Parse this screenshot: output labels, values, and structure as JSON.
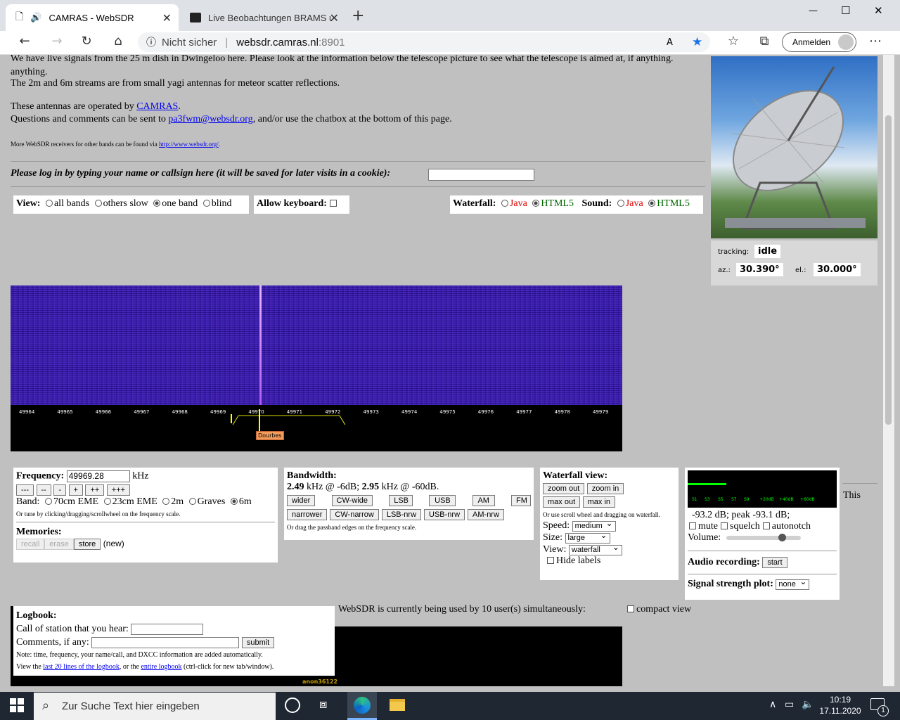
{
  "browser": {
    "tabs": [
      {
        "title": "CAMRAS - WebSDR",
        "close": "✕"
      },
      {
        "title": "Live Beobachtungen BRAMS und",
        "close": "✕"
      }
    ],
    "new_tab": "+",
    "window_controls": {
      "minimize": "—",
      "maximize": "☐",
      "close": "✕"
    },
    "security_label": "Nicht sicher",
    "url_host": "websdr.camras.nl",
    "url_port": ":8901",
    "signin_label": "Anmelden"
  },
  "intro": {
    "line1": "We have live signals from the 25 m dish in Dwingeloo here. Please look at the information below the telescope picture to see what the telescope is aimed at, if anything.",
    "line2": "The 2m and 6m streams are from small yagi antennas for meteor scatter reflections.",
    "operated_prefix": "These antennas are operated by ",
    "operated_link": "CAMRAS",
    "operated_suffix": ".",
    "questions_prefix": "Questions and comments can be sent to ",
    "questions_link": "pa3fwm@websdr.org",
    "questions_suffix": ", and/or use the chatbox at the bottom of this page.",
    "more_prefix": "More WebSDR receivers for other bands can be found via ",
    "more_link": "http://www.websdr.org/",
    "more_suffix": "."
  },
  "login": {
    "prompt": "Please log in by typing your name or callsign here (it will be saved for later visits in a cookie):",
    "value": ""
  },
  "view": {
    "label": "View:",
    "options": [
      "all bands",
      "others slow",
      "one band",
      "blind"
    ],
    "selected": "one band"
  },
  "keyboard": {
    "label": "Allow keyboard:"
  },
  "waterfall_mode": {
    "label": "Waterfall:",
    "java": "Java",
    "html5": "HTML5"
  },
  "sound_mode": {
    "label": "Sound:",
    "java": "Java",
    "html5": "HTML5"
  },
  "telescope": {
    "tracking_label": "tracking:",
    "tracking_value": "idle",
    "az_label": "az.:",
    "az_value": "30.390°",
    "el_label": "el.:",
    "el_value": "30.000°"
  },
  "scale": {
    "ticks": [
      "49964",
      "49965",
      "49966",
      "49967",
      "49968",
      "49969",
      "49970",
      "49971",
      "49972",
      "49973",
      "49974",
      "49975",
      "49976",
      "49977",
      "49978",
      "49979"
    ],
    "station_label": "Dourbes"
  },
  "frequency": {
    "label": "Frequency:",
    "value": "49969.28",
    "unit": "kHz",
    "step_buttons": [
      "---",
      "--",
      "-",
      "+",
      "++",
      "+++"
    ],
    "band_label": "Band:",
    "bands": [
      "70cm EME",
      "23cm EME",
      "2m",
      "Graves",
      "6m"
    ],
    "band_selected": "6m",
    "hint": "Or tune by clicking/dragging/scrollwheel on the frequency scale.",
    "memories_label": "Memories:",
    "mem_recall": "recall",
    "mem_erase": "erase",
    "mem_store": "store",
    "mem_new": "(new)"
  },
  "bandwidth": {
    "label": "Bandwidth:",
    "bw1": "2.49",
    "bw1_text": " kHz @ -6dB; ",
    "bw2": "2.95",
    "bw2_text": " kHz @ -60dB.",
    "row1": [
      "wider",
      "CW-wide",
      "LSB",
      "USB",
      "AM",
      "FM"
    ],
    "row2": [
      "narrower",
      "CW-narrow",
      "LSB-nrw",
      "USB-nrw",
      "AM-nrw"
    ],
    "hint": "Or drag the passband edges on the frequency scale."
  },
  "waterfall_view": {
    "label": "Waterfall view:",
    "zoom_out": "zoom out",
    "zoom_in": "zoom in",
    "max_out": "max out",
    "max_in": "max in",
    "hint": "Or use scroll wheel and dragging on waterfall.",
    "speed_label": "Speed:",
    "speed_value": "medium",
    "size_label": "Size:",
    "size_value": "large",
    "view_label": "View:",
    "view_value": "waterfall",
    "hide_labels": "Hide labels"
  },
  "audio": {
    "smeter_labels": [
      "S1",
      "S3",
      "S5",
      "S7",
      "S9",
      "+20dB",
      "+40dB",
      "+60dB"
    ],
    "level_text": "-93.2 dB; peak   -93.1 dB;",
    "mute": "mute",
    "squelch": "squelch",
    "autonotch": "autonotch",
    "volume_label": "Volume:",
    "recording_label": "Audio recording:",
    "recording_button": "start",
    "signal_plot_label": "Signal strength plot:",
    "signal_plot_value": "none"
  },
  "this_text": "This",
  "logbook": {
    "title": "Logbook:",
    "call_label": "Call of station that you hear:",
    "comments_label": "Comments, if any:",
    "submit": "submit",
    "note": "Note: time, frequency, your name/call, and DXCC information are added automatically.",
    "view_prefix": "View the ",
    "view_link1": "last 20 lines of the logbook",
    "view_mid": ", or the ",
    "view_link2": "entire logbook",
    "view_suffix": " (ctrl-click for new tab/window)."
  },
  "users_text": "WebSDR is currently being used by 10 user(s) simultaneously:",
  "compact_view": "compact view",
  "chat_user": "anon36122",
  "taskbar": {
    "search_placeholder": "Zur Suche Text hier eingeben",
    "time": "10:19",
    "date": "17.11.2020",
    "notification_count": "1"
  }
}
